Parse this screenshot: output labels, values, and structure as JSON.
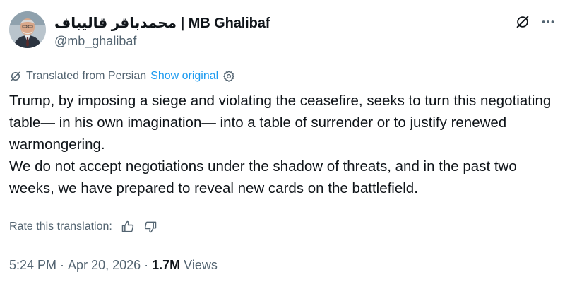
{
  "author": {
    "display_name": "محمدباقر قالیباف | MB Ghalibaf",
    "handle": "@mb_ghalibaf"
  },
  "translation": {
    "label": "Translated from Persian",
    "show_original": "Show original"
  },
  "tweet": {
    "paragraphs": [
      "Trump, by imposing a siege and violating the ceasefire, seeks to turn this negotiating table— in his own imagination— into a table of surrender or to justify renewed warmongering.",
      "We do not accept negotiations under the shadow of threats, and in the past two weeks, we have prepared to reveal new cards on the battlefield."
    ]
  },
  "rating": {
    "label": "Rate this translation:"
  },
  "meta": {
    "time": "5:24 PM",
    "separator": "·",
    "date": "Apr 20, 2026",
    "views_count": "1.7M",
    "views_label": "Views"
  },
  "icons": {
    "grok": "grok-icon",
    "more": "more-icon",
    "translate": "translate-icon",
    "settings": "gear-icon",
    "thumbs_up": "thumbs-up-icon",
    "thumbs_down": "thumbs-down-icon"
  },
  "colors": {
    "accent": "#1d9bf0",
    "secondary_text": "#536471",
    "primary_text": "#0f1419"
  }
}
